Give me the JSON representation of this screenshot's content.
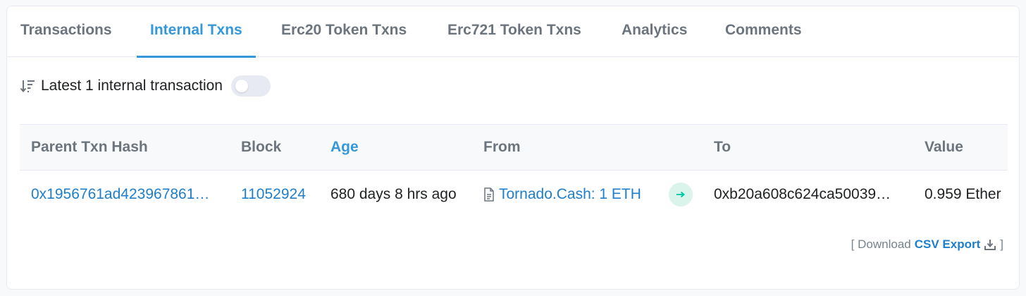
{
  "tabs": [
    {
      "label": "Transactions"
    },
    {
      "label": "Internal Txns",
      "active": true
    },
    {
      "label": "Erc20 Token Txns"
    },
    {
      "label": "Erc721 Token Txns"
    },
    {
      "label": "Analytics"
    },
    {
      "label": "Comments"
    }
  ],
  "filter": {
    "label": "Latest 1 internal transaction",
    "toggle_on": false,
    "sort_icon": "sort-down-icon"
  },
  "table": {
    "columns": [
      "Parent Txn Hash",
      "Block",
      "Age",
      "From",
      "To",
      "Value"
    ],
    "rows": [
      {
        "parent_txn_hash": "0x1956761ad423967861…",
        "block": "11052924",
        "age": "680 days 8 hrs ago",
        "from": "Tornado.Cash: 1 ETH",
        "to": "0xb20a608c624ca50039…",
        "value": "0.959 Ether"
      }
    ]
  },
  "footer": {
    "prefix": "[ Download",
    "link": "CSV Export",
    "suffix": "]"
  },
  "colors": {
    "accent": "#3498db",
    "link": "#1e7ecb",
    "muted": "#6c757e",
    "success_bg": "#daf4eb",
    "success": "#00c9a7"
  }
}
